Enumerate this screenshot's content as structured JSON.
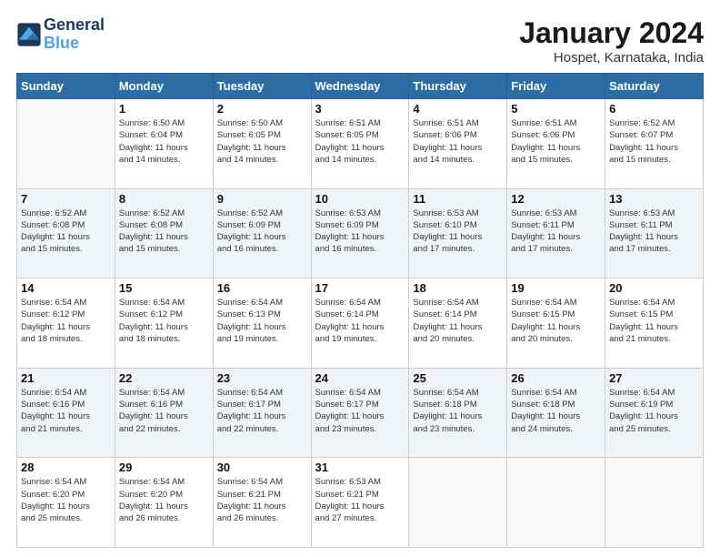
{
  "logo": {
    "line1": "General",
    "line2": "Blue"
  },
  "title": "January 2024",
  "subtitle": "Hospet, Karnataka, India",
  "weekdays": [
    "Sunday",
    "Monday",
    "Tuesday",
    "Wednesday",
    "Thursday",
    "Friday",
    "Saturday"
  ],
  "weeks": [
    [
      {
        "day": "",
        "info": ""
      },
      {
        "day": "1",
        "info": "Sunrise: 6:50 AM\nSunset: 6:04 PM\nDaylight: 11 hours\nand 14 minutes."
      },
      {
        "day": "2",
        "info": "Sunrise: 6:50 AM\nSunset: 6:05 PM\nDaylight: 11 hours\nand 14 minutes."
      },
      {
        "day": "3",
        "info": "Sunrise: 6:51 AM\nSunset: 6:05 PM\nDaylight: 11 hours\nand 14 minutes."
      },
      {
        "day": "4",
        "info": "Sunrise: 6:51 AM\nSunset: 6:06 PM\nDaylight: 11 hours\nand 14 minutes."
      },
      {
        "day": "5",
        "info": "Sunrise: 6:51 AM\nSunset: 6:06 PM\nDaylight: 11 hours\nand 15 minutes."
      },
      {
        "day": "6",
        "info": "Sunrise: 6:52 AM\nSunset: 6:07 PM\nDaylight: 11 hours\nand 15 minutes."
      }
    ],
    [
      {
        "day": "7",
        "info": "Sunrise: 6:52 AM\nSunset: 6:08 PM\nDaylight: 11 hours\nand 15 minutes."
      },
      {
        "day": "8",
        "info": "Sunrise: 6:52 AM\nSunset: 6:08 PM\nDaylight: 11 hours\nand 15 minutes."
      },
      {
        "day": "9",
        "info": "Sunrise: 6:52 AM\nSunset: 6:09 PM\nDaylight: 11 hours\nand 16 minutes."
      },
      {
        "day": "10",
        "info": "Sunrise: 6:53 AM\nSunset: 6:09 PM\nDaylight: 11 hours\nand 16 minutes."
      },
      {
        "day": "11",
        "info": "Sunrise: 6:53 AM\nSunset: 6:10 PM\nDaylight: 11 hours\nand 17 minutes."
      },
      {
        "day": "12",
        "info": "Sunrise: 6:53 AM\nSunset: 6:11 PM\nDaylight: 11 hours\nand 17 minutes."
      },
      {
        "day": "13",
        "info": "Sunrise: 6:53 AM\nSunset: 6:11 PM\nDaylight: 11 hours\nand 17 minutes."
      }
    ],
    [
      {
        "day": "14",
        "info": "Sunrise: 6:54 AM\nSunset: 6:12 PM\nDaylight: 11 hours\nand 18 minutes."
      },
      {
        "day": "15",
        "info": "Sunrise: 6:54 AM\nSunset: 6:12 PM\nDaylight: 11 hours\nand 18 minutes."
      },
      {
        "day": "16",
        "info": "Sunrise: 6:54 AM\nSunset: 6:13 PM\nDaylight: 11 hours\nand 19 minutes."
      },
      {
        "day": "17",
        "info": "Sunrise: 6:54 AM\nSunset: 6:14 PM\nDaylight: 11 hours\nand 19 minutes."
      },
      {
        "day": "18",
        "info": "Sunrise: 6:54 AM\nSunset: 6:14 PM\nDaylight: 11 hours\nand 20 minutes."
      },
      {
        "day": "19",
        "info": "Sunrise: 6:54 AM\nSunset: 6:15 PM\nDaylight: 11 hours\nand 20 minutes."
      },
      {
        "day": "20",
        "info": "Sunrise: 6:54 AM\nSunset: 6:15 PM\nDaylight: 11 hours\nand 21 minutes."
      }
    ],
    [
      {
        "day": "21",
        "info": "Sunrise: 6:54 AM\nSunset: 6:16 PM\nDaylight: 11 hours\nand 21 minutes."
      },
      {
        "day": "22",
        "info": "Sunrise: 6:54 AM\nSunset: 6:16 PM\nDaylight: 11 hours\nand 22 minutes."
      },
      {
        "day": "23",
        "info": "Sunrise: 6:54 AM\nSunset: 6:17 PM\nDaylight: 11 hours\nand 22 minutes."
      },
      {
        "day": "24",
        "info": "Sunrise: 6:54 AM\nSunset: 6:17 PM\nDaylight: 11 hours\nand 23 minutes."
      },
      {
        "day": "25",
        "info": "Sunrise: 6:54 AM\nSunset: 6:18 PM\nDaylight: 11 hours\nand 23 minutes."
      },
      {
        "day": "26",
        "info": "Sunrise: 6:54 AM\nSunset: 6:18 PM\nDaylight: 11 hours\nand 24 minutes."
      },
      {
        "day": "27",
        "info": "Sunrise: 6:54 AM\nSunset: 6:19 PM\nDaylight: 11 hours\nand 25 minutes."
      }
    ],
    [
      {
        "day": "28",
        "info": "Sunrise: 6:54 AM\nSunset: 6:20 PM\nDaylight: 11 hours\nand 25 minutes."
      },
      {
        "day": "29",
        "info": "Sunrise: 6:54 AM\nSunset: 6:20 PM\nDaylight: 11 hours\nand 26 minutes."
      },
      {
        "day": "30",
        "info": "Sunrise: 6:54 AM\nSunset: 6:21 PM\nDaylight: 11 hours\nand 26 minutes."
      },
      {
        "day": "31",
        "info": "Sunrise: 6:53 AM\nSunset: 6:21 PM\nDaylight: 11 hours\nand 27 minutes."
      },
      {
        "day": "",
        "info": ""
      },
      {
        "day": "",
        "info": ""
      },
      {
        "day": "",
        "info": ""
      }
    ]
  ]
}
